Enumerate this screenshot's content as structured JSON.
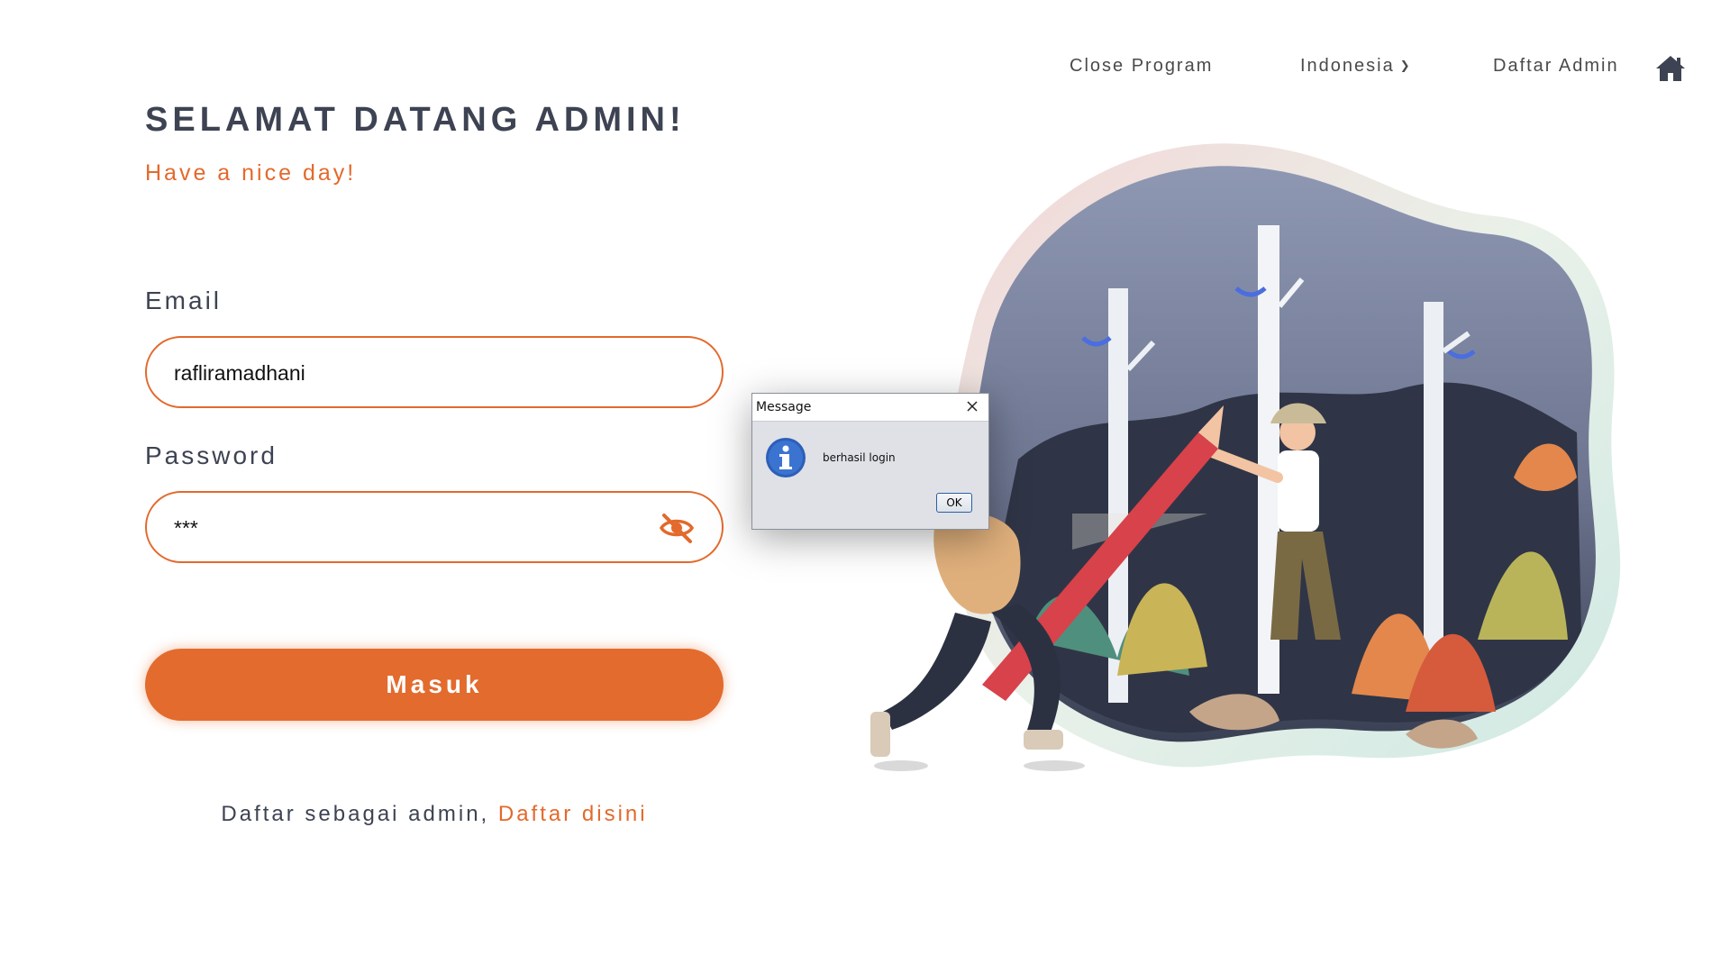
{
  "nav": {
    "close_program": "Close Program",
    "language": "Indonesia",
    "register_admin": "Daftar Admin",
    "home_icon": "home-icon"
  },
  "header": {
    "title": "SELAMAT DATANG ADMIN!",
    "subtitle": "Have a nice day!"
  },
  "form": {
    "email_label": "Email",
    "email_value": "rafliramadhani",
    "password_label": "Password",
    "password_value": "***",
    "toggle_icon": "eye-off-icon",
    "submit_label": "Masuk"
  },
  "register": {
    "prompt": "Daftar sebagai admin,",
    "link": "Daftar disini"
  },
  "dialog": {
    "title": "Message",
    "message": "berhasil login",
    "ok_label": "OK",
    "icon": "info-icon"
  },
  "colors": {
    "accent": "#e3692c",
    "text_dark": "#3d4352"
  }
}
